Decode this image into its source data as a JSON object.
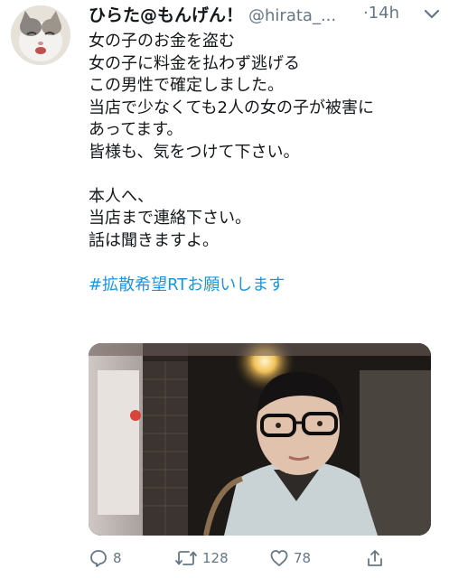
{
  "tweet": {
    "display_name": "ひらた@もんげん！",
    "handle": "@hirata_...",
    "time": "·14h",
    "text_lines": [
      "女の子のお金を盗む",
      "女の子に料金を払わず逃げる",
      "この男性で確定しました。",
      "当店で少なくても2人の女の子が被害に",
      "あってます。",
      "皆様も、気をつけて下さい。",
      "",
      "本人へ、",
      "当店まで連絡下さい。",
      "話は聞きますよ。",
      ""
    ],
    "hashtag": "#拡散希望RTお願いします"
  },
  "actions": {
    "reply_count": "8",
    "retweet_count": "128",
    "like_count": "78"
  },
  "icons": {
    "caret": "chevron-down-icon",
    "reply": "reply-icon",
    "retweet": "retweet-icon",
    "like": "heart-icon",
    "share": "share-icon"
  },
  "colors": {
    "text": "#14171a",
    "secondary": "#657786",
    "link": "#1b95e0"
  }
}
